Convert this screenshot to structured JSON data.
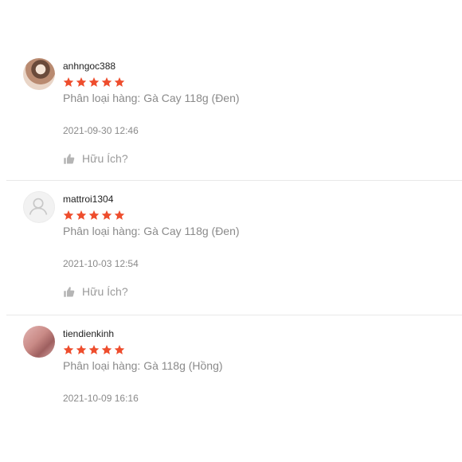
{
  "reviews": [
    {
      "username": "anhngoc388",
      "rating": 5,
      "variant": "Phân loại hàng: Gà Cay 118g (Đen)",
      "time": "2021-09-30 12:46",
      "helpful_label": "Hữu Ích?"
    },
    {
      "username": "mattroi1304",
      "rating": 5,
      "variant": "Phân loại hàng: Gà Cay 118g (Đen)",
      "time": "2021-10-03 12:54",
      "helpful_label": "Hữu Ích?"
    },
    {
      "username": "tiendienkinh",
      "rating": 5,
      "variant": "Phân loại hàng: Gà 118g (Hồng)",
      "time": "2021-10-09 16:16"
    }
  ],
  "colors": {
    "star": "#ee4d2d",
    "muted_text": "#8a8a8a",
    "divider": "#e8e8e8"
  }
}
